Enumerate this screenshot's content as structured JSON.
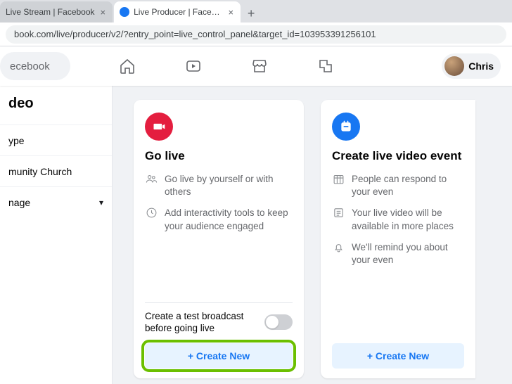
{
  "browser": {
    "tabs": [
      {
        "title": "Live Stream | Facebook"
      },
      {
        "title": "Live Producer | Facebook"
      }
    ],
    "url": "book.com/live/producer/v2/?entry_point=live_control_panel&target_id=103953391256101"
  },
  "header": {
    "search_placeholder": "ecebook",
    "profile_name": "Chris"
  },
  "sidebar": {
    "title": "deo",
    "items": [
      {
        "label": "ype"
      },
      {
        "label": "munity Church"
      },
      {
        "label": "nage",
        "dropdown": true
      }
    ]
  },
  "cards": {
    "go_live": {
      "title": "Go live",
      "features": [
        "Go live by yourself or with others",
        "Add interactivity tools to keep your audience engaged"
      ],
      "toggle_label": "Create a test broadcast before going live",
      "cta": "+ Create New"
    },
    "event": {
      "title": "Create live video event",
      "features": [
        "People can respond to your even",
        "Your live video will be available in more places",
        "We'll remind you about your even"
      ],
      "cta": "+ Create New"
    }
  }
}
